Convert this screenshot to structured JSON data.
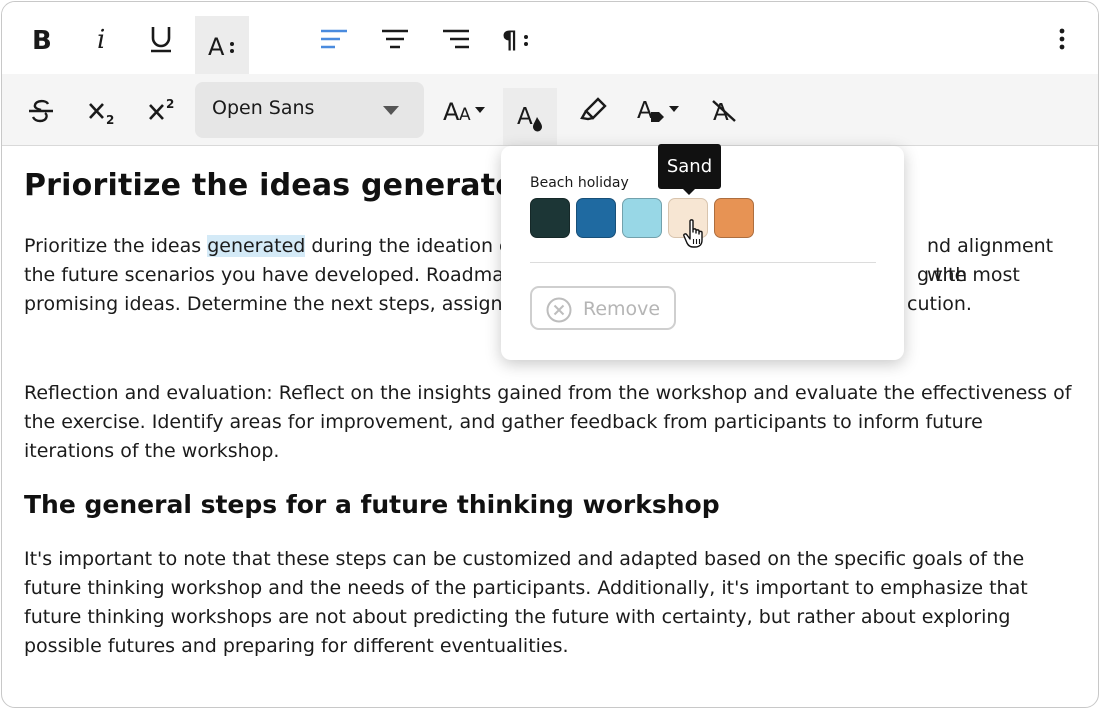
{
  "toolbar": {
    "font_family": "Open Sans",
    "accent_color": "#4a8bde",
    "row1": [
      {
        "name": "bold-button",
        "icon": "bold-icon",
        "glyph": "B"
      },
      {
        "name": "italic-button",
        "icon": "italic-icon",
        "glyph": "i"
      },
      {
        "name": "underline-button",
        "icon": "underline-icon",
        "glyph": "U"
      },
      {
        "name": "text-style-button",
        "icon": "text-style-icon",
        "glyph": "A⁝"
      },
      {
        "name": "align-left-button",
        "icon": "align-left-icon"
      },
      {
        "name": "align-center-button",
        "icon": "align-center-icon"
      },
      {
        "name": "align-right-button",
        "icon": "align-right-icon"
      },
      {
        "name": "paragraph-button",
        "icon": "paragraph-icon",
        "glyph": "¶⁝"
      },
      {
        "name": "more-button",
        "icon": "more-vertical-icon"
      }
    ],
    "row2": [
      {
        "name": "strikethrough-button",
        "icon": "strikethrough-icon"
      },
      {
        "name": "subscript-button",
        "icon": "subscript-icon"
      },
      {
        "name": "superscript-button",
        "icon": "superscript-icon"
      },
      {
        "name": "font-size-button",
        "icon": "font-size-icon"
      },
      {
        "name": "text-color-button",
        "icon": "text-color-icon"
      },
      {
        "name": "highlight-button",
        "icon": "highlighter-icon"
      },
      {
        "name": "text-tag-button",
        "icon": "text-tag-icon"
      },
      {
        "name": "clear-format-button",
        "icon": "clear-format-icon"
      }
    ]
  },
  "document": {
    "heading1": "Prioritize the ideas generated",
    "para1": {
      "lines": [
        [
          "Prioritize the ideas ",
          "generated",
          " during the ideation e",
          "nd alignment with"
        ],
        [
          "the future scenarios you have developed. Roadmap",
          "g the most"
        ],
        [
          "promising ideas. Determine the next steps, assign c",
          "cution."
        ]
      ]
    },
    "para2": "Reflection and evaluation: Reflect on the insights gained from the workshop and evaluate the effectiveness of the exercise. Identify areas for improvement, and gather feedback from participants to inform future iterations of the workshop.",
    "heading2": "The general steps for a future thinking workshop",
    "para3": "It's important to note that these steps can be customized and adapted based on the specific goals of the future thinking workshop and the needs of the participants. Additionally, it's important to emphasize that future thinking workshops are not about predicting the future with certainty, but rather about exploring possible futures and preparing for different eventualities."
  },
  "color_popover": {
    "palette_name": "Beach holiday",
    "swatches": [
      {
        "color": "#1c3636"
      },
      {
        "color": "#1f6aa1"
      },
      {
        "color": "#98d7e6"
      },
      {
        "color": "#f7e6d3"
      },
      {
        "color": "#e79354"
      }
    ],
    "hovered_swatch_tooltip": "Sand",
    "remove_label": "Remove"
  }
}
